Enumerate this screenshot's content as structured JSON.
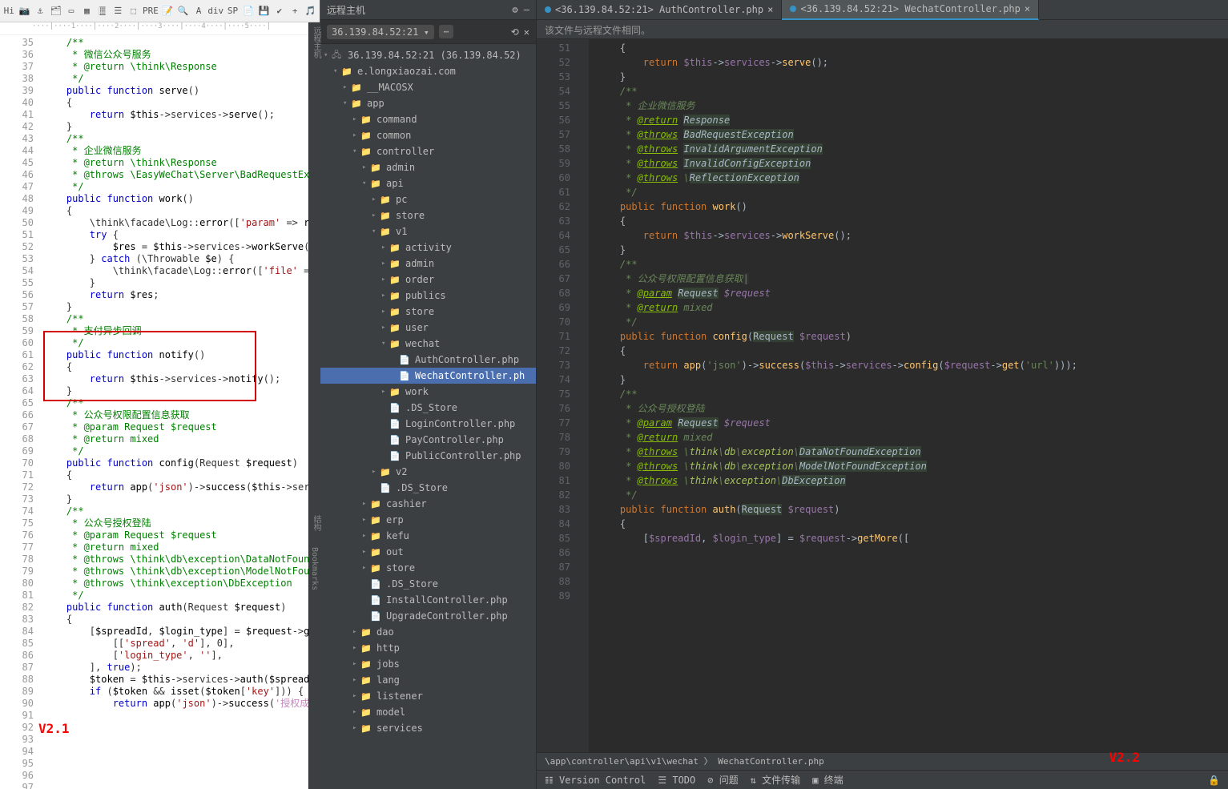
{
  "toolbar_icons": [
    "Hi",
    "📷",
    "⚓",
    "🗂",
    "▭",
    "▦",
    "🀘",
    "☰",
    "⬚",
    "PRE",
    "📝",
    "🔍",
    "A",
    "div",
    "SP",
    "📄",
    "💾",
    "✔",
    "+",
    "🎵"
  ],
  "ruler": "····|····1····|····2····|····3····|····4····|····5····|",
  "left_lines": [
    35,
    36,
    37,
    38,
    39,
    40,
    41,
    42,
    43,
    44,
    45,
    46,
    47,
    48,
    49,
    50,
    51,
    52,
    53,
    54,
    55,
    56,
    57,
    58,
    59,
    60,
    61,
    62,
    63,
    64,
    65,
    66,
    67,
    68,
    69,
    70,
    71,
    72,
    73,
    74,
    75,
    76,
    77,
    78,
    79,
    80,
    81,
    82,
    83,
    84,
    85,
    86,
    87,
    88,
    89,
    90,
    91,
    92,
    93,
    94,
    95,
    96,
    97
  ],
  "left_code_html": [
    "",
    "    <span class='cm'>/**</span>",
    "    <span class='cm'> * 微信公众号服务</span>",
    "    <span class='cm'> * @return \\think\\Response</span>",
    "    <span class='cm'> */</span>",
    "    <span class='kw'>public function</span> <span class='fn'>serve</span>()",
    "    {",
    "        <span class='kw'>return</span> <span class='var'>$this</span>->services-><span class='fn'>serve</span>();",
    "    }",
    "",
    "    <span class='cm'>/**</span>",
    "    <span class='cm'> * 企业微信服务</span>",
    "    <span class='cm'> * @return \\think\\Response</span>",
    "    <span class='cm'> * @throws \\EasyWeChat\\Server\\BadRequestException</span>",
    "    <span class='cm'> */</span>",
    "    <span class='kw'>public function</span> <span class='fn'>work</span>()",
    "    {",
    "        \\think\\facade\\Log::<span class='fn'>error</span>([<span class='str'>'param'</span> => <span class='fn'>request</span>()",
    "        <span class='kw'>try</span> {",
    "            <span class='var'>$res</span> = <span class='var'>$this</span>->services-><span class='fn'>workServe</span>();",
    "        } <span class='kw'>catch</span> (\\Throwable <span class='var'>$e</span>) {",
    "            \\think\\facade\\Log::<span class='fn'>error</span>([<span class='str'>'file'</span> => <span class='var'>$e</span>->ge",
    "        }",
    "",
    "        <span class='kw'>return</span> <span class='var'>$res</span>;",
    "    }",
    "",
    "    <span class='cm'>/**</span>",
    "    <span class='cm'> * 支付异步回调</span>",
    "    <span class='cm'> */</span>",
    "    <span class='kw'>public function</span> <span class='fn'>notify</span>()",
    "    {",
    "        <span class='kw'>return</span> <span class='var'>$this</span>->services-><span class='fn'>notify</span>();",
    "    }",
    "",
    "    <span class='cm'>/**</span>",
    "    <span class='cm'> * 公众号权限配置信息获取</span>",
    "    <span class='cm'> * @param Request $request</span>",
    "    <span class='cm'> * @return mixed</span>",
    "    <span class='cm'> */</span>",
    "    <span class='kw'>public function</span> <span class='fn'>config</span>(Request <span class='var'>$request</span>)",
    "    {",
    "        <span class='kw'>return</span> <span class='fn'>app</span>(<span class='str'>'json'</span>)-><span class='fn'>success</span>(<span class='var'>$this</span>->services->c",
    "    }",
    "",
    "    <span class='cm'>/**</span>",
    "    <span class='cm'> * 公众号授权登陆</span>",
    "    <span class='cm'> * @param Request $request</span>",
    "    <span class='cm'> * @return mixed</span>",
    "    <span class='cm'> * @throws \\think\\db\\exception\\DataNotFoundExcept</span>",
    "    <span class='cm'> * @throws \\think\\db\\exception\\ModelNotFoundExcep</span>",
    "    <span class='cm'> * @throws \\think\\exception\\DbException</span>",
    "    <span class='cm'> */</span>",
    "    <span class='kw'>public function</span> <span class='fn'>auth</span>(Request <span class='var'>$request</span>)",
    "    {",
    "        [<span class='var'>$spreadId</span>, <span class='var'>$login_type</span>] = <span class='var'>$request</span>-><span class='fn'>getMore</span>(",
    "            [[<span class='str'>'spread'</span>, <span class='str'>'d'</span>], 0],",
    "            [<span class='str'>'login_type'</span>, <span class='str'>''</span>],",
    "        ], <span class='kw'>true</span>);",
    "        <span class='var'>$token</span> = <span class='var'>$this</span>->services-><span class='fn'>auth</span>(<span class='var'>$spreadId</span>, <span class='var'>$lo</span>",
    "        <span class='kw'>if</span> (<span class='var'>$token</span> && <span class='fn'>isset</span>(<span class='var'>$token</span>[<span class='str'>'key'</span>])) {",
    "            <span class='kw'>return</span> <span class='fn'>app</span>(<span class='str'>'json'</span>)-><span class='fn'>success</span>(<span class='str' style='color:#c586c0'>'授权成功, 请</span>"
  ],
  "version_left": "V2.1",
  "mid_title": "远程主机",
  "host_label": "36.139.84.52:21",
  "root": "36.139.84.52:21 (36.139.84.52)",
  "tree": [
    {
      "d": 1,
      "i": "📁",
      "l": "e.longxiaozai.com",
      "c": "▾"
    },
    {
      "d": 2,
      "i": "📁",
      "l": "__MACOSX",
      "c": "▸"
    },
    {
      "d": 2,
      "i": "📁",
      "l": "app",
      "c": "▾"
    },
    {
      "d": 3,
      "i": "📁",
      "l": "command",
      "c": "▸"
    },
    {
      "d": 3,
      "i": "📁",
      "l": "common",
      "c": "▸"
    },
    {
      "d": 3,
      "i": "📁",
      "l": "controller",
      "c": "▾"
    },
    {
      "d": 4,
      "i": "📁",
      "l": "admin",
      "c": "▸"
    },
    {
      "d": 4,
      "i": "📁",
      "l": "api",
      "c": "▾"
    },
    {
      "d": 5,
      "i": "📁",
      "l": "pc",
      "c": "▸"
    },
    {
      "d": 5,
      "i": "📁",
      "l": "store",
      "c": "▸"
    },
    {
      "d": 5,
      "i": "📁",
      "l": "v1",
      "c": "▾"
    },
    {
      "d": 6,
      "i": "📁",
      "l": "activity",
      "c": "▸"
    },
    {
      "d": 6,
      "i": "📁",
      "l": "admin",
      "c": "▸"
    },
    {
      "d": 6,
      "i": "📁",
      "l": "order",
      "c": "▸"
    },
    {
      "d": 6,
      "i": "📁",
      "l": "publics",
      "c": "▸"
    },
    {
      "d": 6,
      "i": "📁",
      "l": "store",
      "c": "▸"
    },
    {
      "d": 6,
      "i": "📁",
      "l": "user",
      "c": "▸"
    },
    {
      "d": 6,
      "i": "📁",
      "l": "wechat",
      "c": "▾"
    },
    {
      "d": 7,
      "i": "📄",
      "l": "AuthController.php",
      "c": ""
    },
    {
      "d": 7,
      "i": "📄",
      "l": "WechatController.ph",
      "c": "",
      "sel": true
    },
    {
      "d": 6,
      "i": "📁",
      "l": "work",
      "c": "▸"
    },
    {
      "d": 6,
      "i": "📄",
      "l": ".DS_Store",
      "c": ""
    },
    {
      "d": 6,
      "i": "📄",
      "l": "LoginController.php",
      "c": ""
    },
    {
      "d": 6,
      "i": "📄",
      "l": "PayController.php",
      "c": ""
    },
    {
      "d": 6,
      "i": "📄",
      "l": "PublicController.php",
      "c": ""
    },
    {
      "d": 5,
      "i": "📁",
      "l": "v2",
      "c": "▸"
    },
    {
      "d": 5,
      "i": "📄",
      "l": ".DS_Store",
      "c": ""
    },
    {
      "d": 4,
      "i": "📁",
      "l": "cashier",
      "c": "▸"
    },
    {
      "d": 4,
      "i": "📁",
      "l": "erp",
      "c": "▸"
    },
    {
      "d": 4,
      "i": "📁",
      "l": "kefu",
      "c": "▸"
    },
    {
      "d": 4,
      "i": "📁",
      "l": "out",
      "c": "▸"
    },
    {
      "d": 4,
      "i": "📁",
      "l": "store",
      "c": "▸"
    },
    {
      "d": 4,
      "i": "📄",
      "l": ".DS_Store",
      "c": ""
    },
    {
      "d": 4,
      "i": "📄",
      "l": "InstallController.php",
      "c": ""
    },
    {
      "d": 4,
      "i": "📄",
      "l": "UpgradeController.php",
      "c": ""
    },
    {
      "d": 3,
      "i": "📁",
      "l": "dao",
      "c": "▸"
    },
    {
      "d": 3,
      "i": "📁",
      "l": "http",
      "c": "▸"
    },
    {
      "d": 3,
      "i": "📁",
      "l": "jobs",
      "c": "▸"
    },
    {
      "d": 3,
      "i": "📁",
      "l": "lang",
      "c": "▸"
    },
    {
      "d": 3,
      "i": "📁",
      "l": "listener",
      "c": "▸"
    },
    {
      "d": 3,
      "i": "📁",
      "l": "model",
      "c": "▸"
    },
    {
      "d": 3,
      "i": "📁",
      "l": "services",
      "c": "▸"
    }
  ],
  "tab_a": "<36.139.84.52:21> AuthController.php",
  "tab_b": "<36.139.84.52:21> WechatController.php",
  "info": "该文件与远程文件相同。",
  "right_lines": [
    51,
    52,
    53,
    54,
    55,
    56,
    57,
    58,
    59,
    60,
    61,
    62,
    63,
    64,
    65,
    66,
    67,
    68,
    69,
    70,
    71,
    72,
    73,
    74,
    75,
    76,
    77,
    78,
    79,
    80,
    81,
    82,
    83,
    84,
    85,
    86,
    87,
    88,
    89
  ],
  "right_code_html": [
    "",
    "    {",
    "        <span class='k2'>return</span> <span class='v2'>$this</span>-><span class='v2'>services</span>-><span class='id2'>serve</span>();",
    "    }",
    "",
    "    <span class='doc'>/**</span>",
    "    <span class='doc'> * 企业微信服务</span>",
    "    <span class='doc'> * <span class='tag'>@return</span> <span class='typ'>Response</span></span>",
    "    <span class='doc'> * <span class='tag'>@throws</span> <span class='typ'>BadRequestException</span></span>",
    "    <span class='doc'> * <span class='tag'>@throws</span> <span class='typ'>InvalidArgumentException</span></span>",
    "    <span class='doc'> * <span class='tag'>@throws</span> <span class='typ'>InvalidConfigException</span></span>",
    "    <span class='doc'> * <span class='tag'>@throws</span> \\<span class='typ'>ReflectionException</span></span>",
    "    <span class='doc'> */</span>",
    "    <span class='k2'>public function</span> <span class='id2'>work</span>()",
    "    {",
    "        <span class='k2'>return</span> <span class='v2'>$this</span>-><span class='v2'>services</span>-><span class='id2'>workServe</span>();",
    "    }",
    "",
    "    <span class='doc'>/**</span>",
    "    <span class='doc'> * 公众号权限配置信息获取<span style='background:#323232'>|</span></span>",
    "    <span class='doc'> * <span class='tag'>@param</span> <span class='typ'>Request</span> <span class='v2'>$request</span></span>",
    "    <span class='doc'> * <span class='tag'>@return</span> mixed</span>",
    "    <span class='doc'> */</span>",
    "    <span class='k2'>public function</span> <span class='id2'>config</span>(<span class='typ'>Request</span> <span class='v2'>$request</span>)",
    "    {",
    "        <span class='k2'>return</span> <span class='id2'>app</span>(<span class='s2'>'json'</span>)-><span class='id2'>success</span>(<span class='v2'>$this</span>-><span class='v2'>services</span>-><span class='id2'>config</span>(<span class='v2'>$request</span>-><span class='id2'>get</span>(<span class='s2'>'url'</span>)));",
    "    }",
    "",
    "    <span class='doc'>/**</span>",
    "    <span class='doc'> * 公众号授权登陆</span>",
    "    <span class='doc'> * <span class='tag'>@param</span> <span class='typ'>Request</span> <span class='v2'>$request</span></span>",
    "    <span class='doc'> * <span class='tag'>@return</span> mixed</span>",
    "    <span class='doc'> * <span class='tag'>@throws</span> \\<span class='lt'>think</span>\\<span class='lt'>db</span>\\<span class='lt'>exception</span>\\<span class='typ'>DataNotFoundException</span></span>",
    "    <span class='doc'> * <span class='tag'>@throws</span> \\<span class='lt'>think</span>\\<span class='lt'>db</span>\\<span class='lt'>exception</span>\\<span class='typ'>ModelNotFoundException</span></span>",
    "    <span class='doc'> * <span class='tag'>@throws</span> \\<span class='lt'>think</span>\\<span class='lt'>exception</span>\\<span class='typ'>DbException</span></span>",
    "    <span class='doc'> */</span>",
    "    <span class='k2'>public function</span> <span class='id2'>auth</span>(<span class='typ'>Request</span> <span class='v2'>$request</span>)",
    "    {",
    "        [<span class='v2'>$spreadId</span>, <span class='v2'>$login_type</span>] = <span class='v2'>$request</span>-><span class='id2'>getMore</span>(["
  ],
  "breadcrumb": "\\app\\controller\\api\\v1\\wechat 〉 WechatController.php",
  "status": {
    "vc": "Version Control",
    "todo": "TODO",
    "problems": "问题",
    "transfer": "文件传输",
    "terminal": "终端"
  },
  "version_right": "V2.2",
  "side_labels": [
    "远程主机",
    "结构",
    "Bookmarks"
  ]
}
